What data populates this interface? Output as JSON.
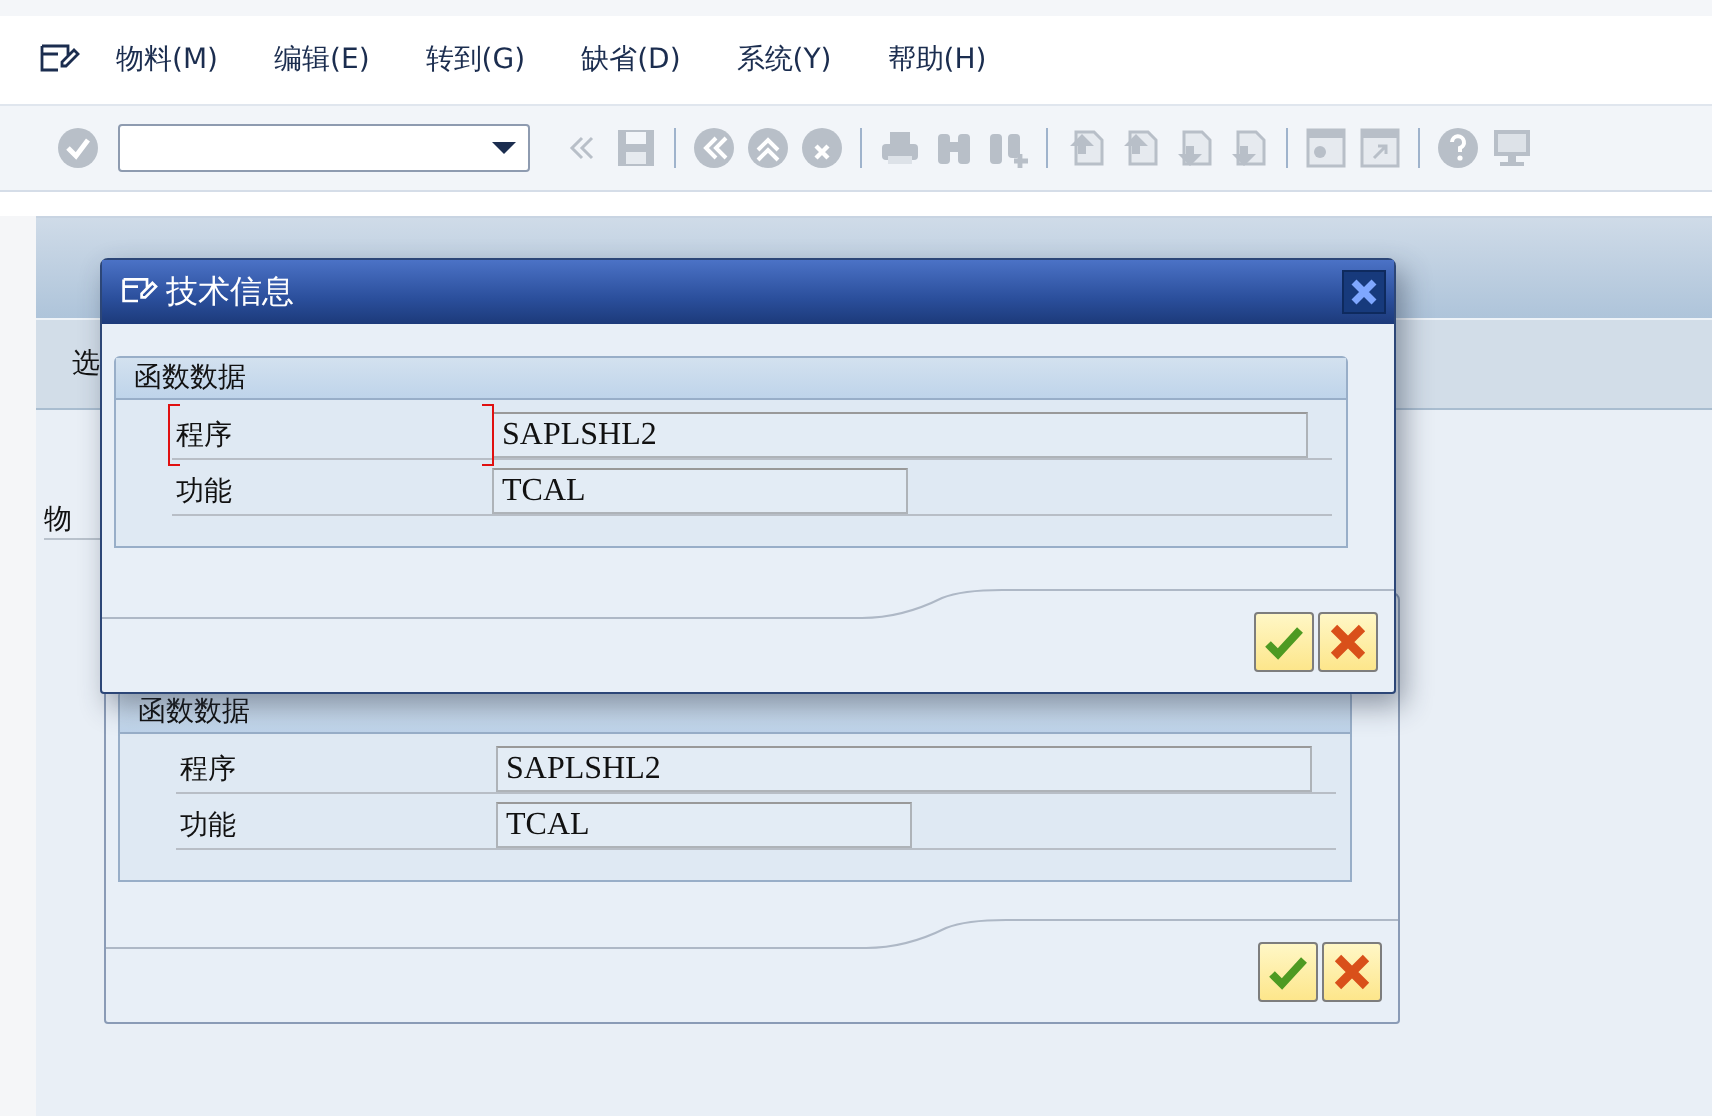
{
  "menu": [
    {
      "label": "物料(M)"
    },
    {
      "label": "编辑(E)"
    },
    {
      "label": "转到(G)"
    },
    {
      "label": "缺省(D)"
    },
    {
      "label": "系统(Y)"
    },
    {
      "label": "帮助(H)"
    }
  ],
  "screen": {
    "toolbar_label": "选",
    "field_label": "物"
  },
  "dialogs": [
    {
      "front": true,
      "title": "技术信息",
      "group": {
        "title": "函数数据",
        "fields": [
          {
            "label": "程序",
            "value": "SAPLSHL2",
            "focused": true
          },
          {
            "label": "功能",
            "value": "TCAL",
            "focused": false
          }
        ]
      }
    },
    {
      "front": false,
      "group": {
        "title": "函数数据",
        "fields": [
          {
            "label": "程序",
            "value": "SAPLSHL2",
            "focused": false
          },
          {
            "label": "功能",
            "value": "TCAL",
            "focused": false
          }
        ]
      }
    }
  ]
}
